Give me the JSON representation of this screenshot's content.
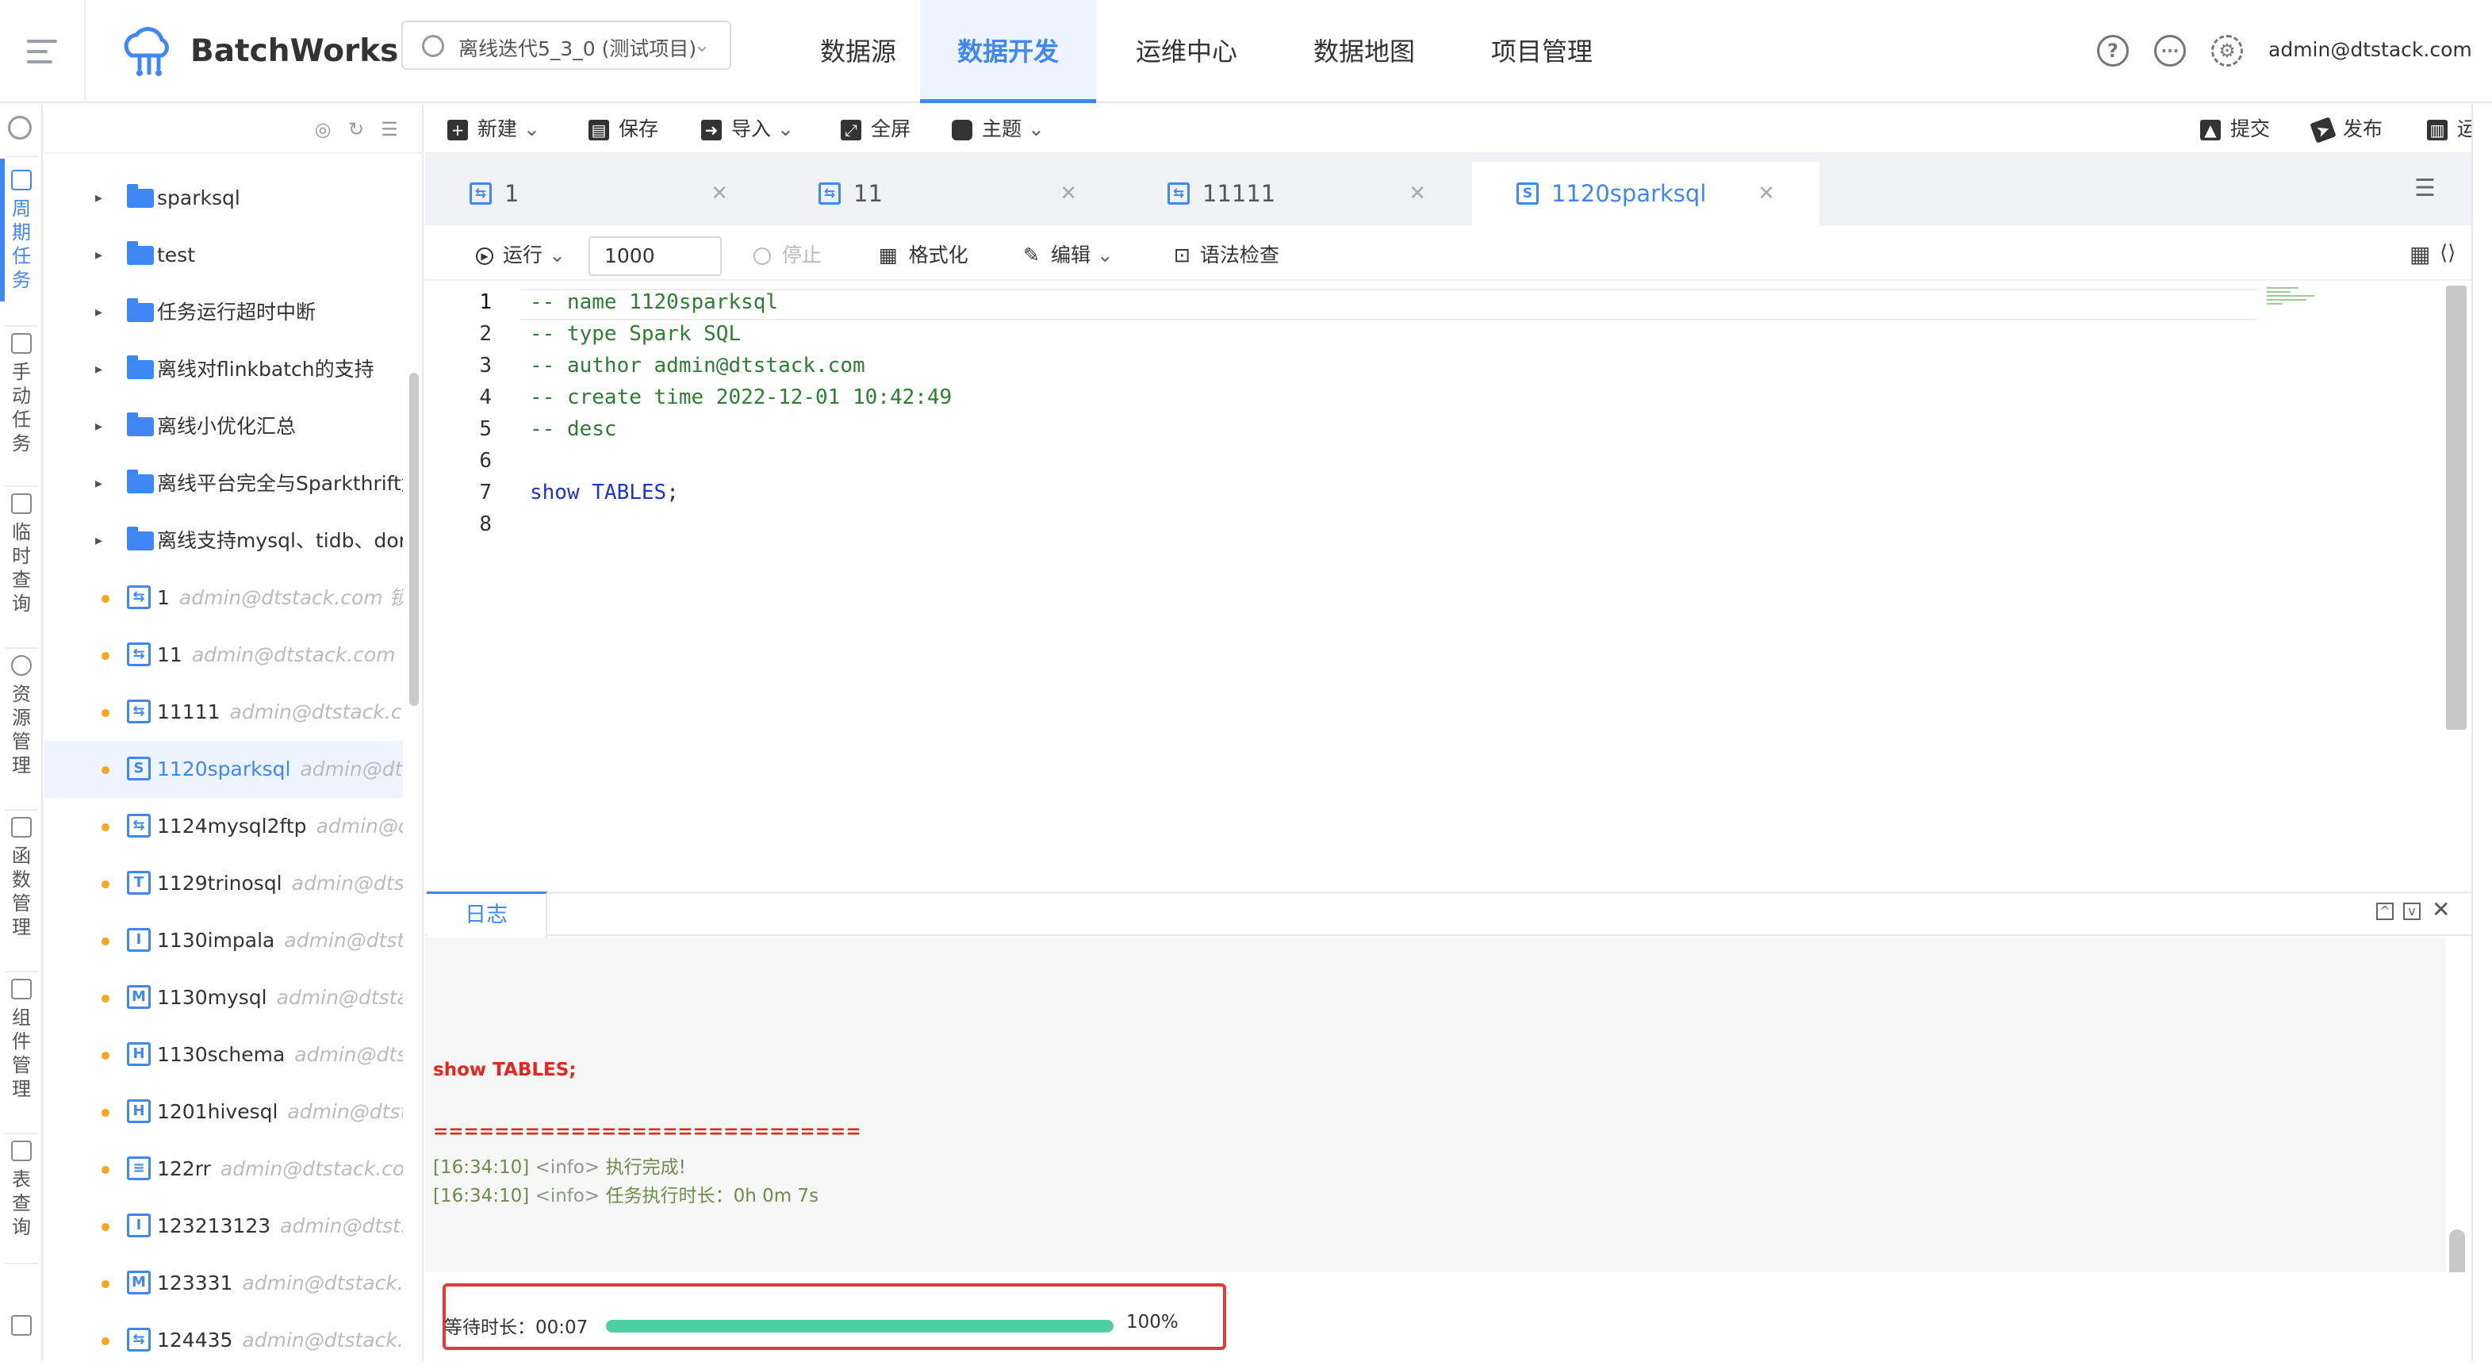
{
  "app": {
    "name": "BatchWorks"
  },
  "project_selector": {
    "value": "离线迭代5_3_0 (测试项目)"
  },
  "nav": {
    "items": [
      {
        "label": "数据源",
        "active": false
      },
      {
        "label": "数据开发",
        "active": true
      },
      {
        "label": "运维中心",
        "active": false
      },
      {
        "label": "数据地图",
        "active": false
      },
      {
        "label": "项目管理",
        "active": false
      }
    ]
  },
  "user": {
    "email": "admin@dtstack.com"
  },
  "rail": {
    "items": [
      {
        "label": "周期任务",
        "icon": "calendar-icon",
        "active": true
      },
      {
        "label": "手动任务",
        "icon": "manual-task-icon",
        "active": false
      },
      {
        "label": "临时查询",
        "icon": "temp-query-icon",
        "active": false
      },
      {
        "label": "资源管理",
        "icon": "resource-icon",
        "active": false
      },
      {
        "label": "函数管理",
        "icon": "function-icon",
        "active": false
      },
      {
        "label": "组件管理",
        "icon": "component-icon",
        "active": false
      },
      {
        "label": "表查询",
        "icon": "table-query-icon",
        "active": false
      }
    ]
  },
  "tree": {
    "rows": [
      {
        "type": "folder",
        "name": "sparksql",
        "meta": ""
      },
      {
        "type": "folder",
        "name": "test",
        "meta": ""
      },
      {
        "type": "folder",
        "name": "任务运行超时中断",
        "meta": ""
      },
      {
        "type": "folder",
        "name": "离线对flinkbatch的支持",
        "meta": ""
      },
      {
        "type": "folder",
        "name": "离线小优化汇总",
        "meta": ""
      },
      {
        "type": "folder",
        "name": "离线平台完全与Sparkthrift解",
        "meta": ""
      },
      {
        "type": "folder",
        "name": "离线支持mysql、tidb、doris",
        "meta": ""
      },
      {
        "type": "task",
        "icon": "sync",
        "name": "1",
        "meta": "admin@dtstack.com 锁..."
      },
      {
        "type": "task",
        "icon": "sync",
        "name": "11",
        "meta": "admin@dtstack.com ..."
      },
      {
        "type": "task",
        "icon": "sync",
        "name": "11111",
        "meta": "admin@dtstack.c..."
      },
      {
        "type": "task",
        "icon": "S",
        "name": "1120sparksql",
        "meta": "admin@dts...",
        "selected": true
      },
      {
        "type": "task",
        "icon": "sync",
        "name": "1124mysql2ftp",
        "meta": "admin@d..."
      },
      {
        "type": "task",
        "icon": "trino",
        "name": "1129trinosql",
        "meta": "admin@dtst..."
      },
      {
        "type": "task",
        "icon": "I",
        "name": "1130impala",
        "meta": "admin@dtsta..."
      },
      {
        "type": "task",
        "icon": "mysql",
        "name": "1130mysql",
        "meta": "admin@dtsta..."
      },
      {
        "type": "task",
        "icon": "H",
        "name": "1130schema",
        "meta": "admin@dtst..."
      },
      {
        "type": "task",
        "icon": "H",
        "name": "1201hivesql",
        "meta": "admin@dtst..."
      },
      {
        "type": "task",
        "icon": "doc",
        "name": "122rr",
        "meta": "admin@dtstack.co..."
      },
      {
        "type": "task",
        "icon": "I",
        "name": "123213123",
        "meta": "admin@dtst..."
      },
      {
        "type": "task",
        "icon": "mysql",
        "name": "123331",
        "meta": "admin@dtstack...."
      },
      {
        "type": "task",
        "icon": "sync",
        "name": "124435",
        "meta": "admin@dtstack...."
      }
    ]
  },
  "toolbar": {
    "new": "新建",
    "save": "保存",
    "import": "导入",
    "fullscreen": "全屏",
    "theme": "主题",
    "submit": "提交",
    "publish": "发布",
    "ops": "运维"
  },
  "tabs": [
    {
      "label": "1",
      "icon": "sync",
      "active": false
    },
    {
      "label": "11",
      "icon": "sync",
      "active": false
    },
    {
      "label": "11111",
      "icon": "sync",
      "active": false
    },
    {
      "label": "1120sparksql",
      "icon": "S",
      "active": true
    }
  ],
  "editor_toolbar": {
    "run": "运行",
    "run_limit": "1000",
    "stop": "停止",
    "format": "格式化",
    "edit": "编辑",
    "syntax_check": "语法检查"
  },
  "code_lines": [
    {
      "n": "1",
      "parts": [
        {
          "t": "-- name 1120sparksql",
          "c": "cmt"
        }
      ]
    },
    {
      "n": "2",
      "parts": [
        {
          "t": "-- type Spark SQL",
          "c": "cmt"
        }
      ]
    },
    {
      "n": "3",
      "parts": [
        {
          "t": "-- author admin@dtstack.com",
          "c": "cmt"
        }
      ]
    },
    {
      "n": "4",
      "parts": [
        {
          "t": "-- create time 2022-12-01 10:42:49",
          "c": "cmt"
        }
      ]
    },
    {
      "n": "5",
      "parts": [
        {
          "t": "-- desc",
          "c": "cmt"
        }
      ]
    },
    {
      "n": "6",
      "parts": []
    },
    {
      "n": "7",
      "parts": [
        {
          "t": "show TABLES",
          "c": "kw"
        },
        {
          "t": ";",
          "c": "pl"
        }
      ]
    },
    {
      "n": "8",
      "parts": []
    }
  ],
  "log": {
    "tab": "日志",
    "sql": "show TABLES;",
    "separator": "============================",
    "lines": [
      {
        "time": "[16:34:10]",
        "tag": "<info>",
        "msg": "执行完成!"
      },
      {
        "time": "[16:34:10]",
        "tag": "<info>",
        "msg": "任务执行时长：0h 0m 7s"
      }
    ]
  },
  "progress": {
    "label": "等待时长：00:07",
    "percent_text": "100%",
    "fraction": 1.0,
    "color": "#4dcfa3"
  },
  "colors": {
    "accent": "#3f87f5",
    "error": "#e5261d"
  }
}
